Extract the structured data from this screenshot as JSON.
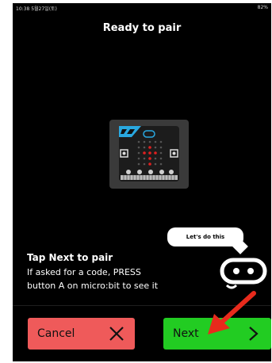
{
  "status_bar": {
    "time_date": "10:38 5월27일(토)",
    "battery": "82%"
  },
  "header": {
    "title": "Ready to pair"
  },
  "mascot_bubble": {
    "text": "Let's do this"
  },
  "instructions": {
    "heading": "Tap Next to pair",
    "line1": "If asked for a code, PRESS",
    "line2": "button A on micro:bit to see it"
  },
  "buttons": {
    "cancel_label": "Cancel",
    "next_label": "Next"
  },
  "colors": {
    "background": "#000000",
    "cancel": "#ef5a5a",
    "next": "#22cc22",
    "annotation_arrow": "#e82a1c",
    "led": "#e02020"
  },
  "icons": {
    "cancel": "close-icon",
    "next": "chevron-right-icon"
  }
}
